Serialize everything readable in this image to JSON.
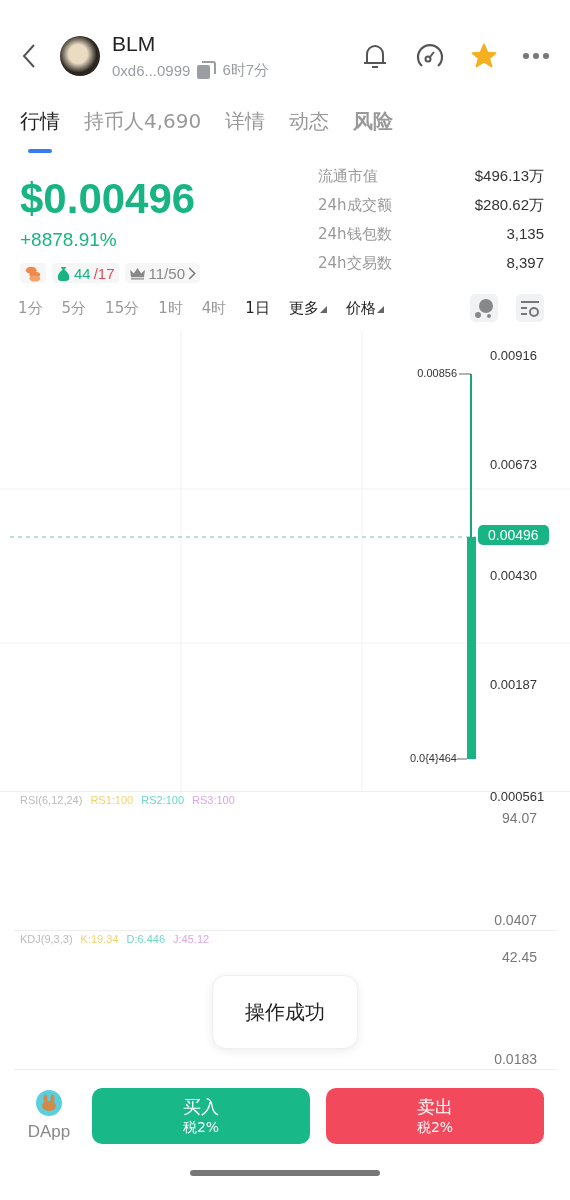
{
  "header": {
    "symbol": "BLM",
    "address": "0xd6...0999",
    "age": "6时7分",
    "favorite": true
  },
  "tabs": [
    {
      "label": "行情",
      "selected": true,
      "bold": false
    },
    {
      "label": "持币人4,690",
      "selected": false,
      "bold": false
    },
    {
      "label": "详情",
      "selected": false,
      "bold": false
    },
    {
      "label": "动态",
      "selected": false,
      "bold": false
    },
    {
      "label": "风险",
      "selected": false,
      "bold": true
    }
  ],
  "price": {
    "value": "$0.00496",
    "change": "+8878.91%",
    "buys": "44",
    "sells": "/17",
    "top_holders": "11/50"
  },
  "stats": [
    {
      "label": "流通市值",
      "value": "$496.13万"
    },
    {
      "label": "24h成交额",
      "value": "$280.62万"
    },
    {
      "label": "24h钱包数",
      "value": "3,135"
    },
    {
      "label": "24h交易数",
      "value": "8,397"
    }
  ],
  "timeframes": [
    {
      "label": "1分",
      "selected": false,
      "kind": "plain"
    },
    {
      "label": "5分",
      "selected": false,
      "kind": "plain"
    },
    {
      "label": "15分",
      "selected": false,
      "kind": "plain"
    },
    {
      "label": "1时",
      "selected": false,
      "kind": "plain"
    },
    {
      "label": "4时",
      "selected": false,
      "kind": "plain"
    },
    {
      "label": "1日",
      "selected": true,
      "kind": "plain"
    },
    {
      "label": "更多",
      "kind": "dropdown"
    },
    {
      "label": "价格",
      "kind": "dropdown"
    }
  ],
  "chart": {
    "y_labels": [
      "0.00916",
      "0.00673",
      "0.00430",
      "0.00187",
      "0.000561"
    ],
    "current_price": "0.00496",
    "high_label": "0.00856",
    "low_label": "0.0{4}464"
  },
  "indicators": [
    {
      "name": "RSI(6,12,24)",
      "values": [
        {
          "text": "RS1:100",
          "color": "#f2d36b"
        },
        {
          "text": "RS2:100",
          "color": "#6fd6c3"
        },
        {
          "text": "RS3:100",
          "color": "#e0a3e8"
        }
      ],
      "axis": [
        "94.07",
        "0.0407"
      ]
    },
    {
      "name": "KDJ(9,3,3)",
      "values": [
        {
          "text": "K:19.34",
          "color": "#f2d36b"
        },
        {
          "text": "D:6.446",
          "color": "#6fd6c3"
        },
        {
          "text": "J:45.12",
          "color": "#e0a3e8"
        }
      ],
      "axis": [
        "42.45",
        "0.0183"
      ]
    }
  ],
  "toast": "操作成功",
  "bottom": {
    "dapp": "DApp",
    "buy": "买入",
    "buy_tax": "税2%",
    "sell": "卖出",
    "sell_tax": "税2%"
  }
}
